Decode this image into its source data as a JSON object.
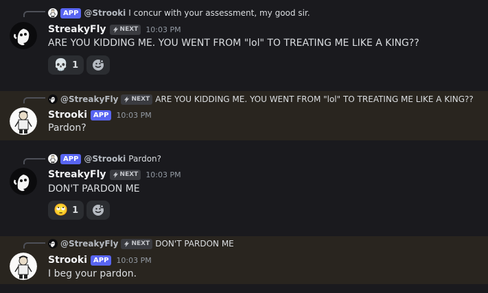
{
  "messages": [
    {
      "reply": {
        "app_badge": "APP",
        "name": "@Strooki",
        "text": "I concur with your assessment, my good sir."
      },
      "author": "StreakyFly",
      "tag": "NEXT",
      "timestamp": "10:03 PM",
      "content": "ARE YOU KIDDING ME. YOU WENT FROM \"lol\" TO TREATING ME LIKE A KING??",
      "reaction": {
        "emoji": "skull-icon",
        "count": "1"
      }
    },
    {
      "reply": {
        "name": "@StreakyFly",
        "tag": "NEXT",
        "text": "ARE YOU KIDDING ME. YOU WENT FROM \"lol\" TO TREATING ME LIKE A KING??"
      },
      "author": "Strooki",
      "app_badge": "APP",
      "timestamp": "10:03 PM",
      "content": "Pardon?"
    },
    {
      "reply": {
        "app_badge": "APP",
        "name": "@Strooki",
        "text": "Pardon?"
      },
      "author": "StreakyFly",
      "tag": "NEXT",
      "timestamp": "10:03 PM",
      "content": "DON'T PARDON ME",
      "reaction": {
        "emoji": "eye-roll-face-icon",
        "count": "1"
      }
    },
    {
      "reply": {
        "name": "@StreakyFly",
        "tag": "NEXT",
        "text": "DON'T PARDON ME"
      },
      "author": "Strooki",
      "app_badge": "APP",
      "timestamp": "10:03 PM",
      "content": "I beg your pardon."
    }
  ],
  "colors": {
    "background": "#1a1a1e",
    "highlight": "#29251f",
    "app_badge": "#5865f2",
    "reaction_bg": "#2b2d31"
  }
}
